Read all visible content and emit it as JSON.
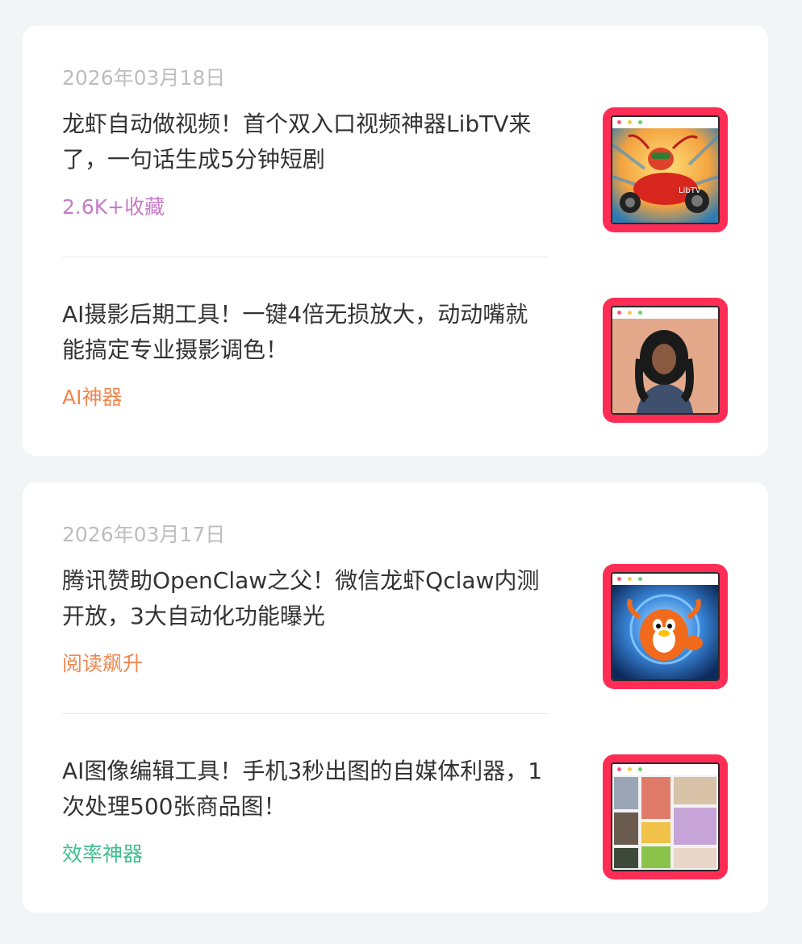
{
  "groups": [
    {
      "date": "2026年03月18日",
      "articles": [
        {
          "title": "龙虾自动做视频！首个双入口视频神器LibTV来了，一句话生成5分钟短剧",
          "tag": "2.6K+收藏",
          "tag_color": "#c57cc8",
          "thumbnail_label": "LibTV"
        },
        {
          "title": "AI摄影后期工具！一键4倍无损放大，动动嘴就能搞定专业摄影调色！",
          "tag": "AI神器",
          "tag_color": "#f0874e"
        }
      ]
    },
    {
      "date": "2026年03月17日",
      "articles": [
        {
          "title": "腾讯赞助OpenClaw之父！微信龙虾Qclaw内测开放，3大自动化功能曝光",
          "tag": "阅读飙升",
          "tag_color": "#f0874e"
        },
        {
          "title": "AI图像编辑工具！手机3秒出图的自媒体利器，1次处理500张商品图！",
          "tag": "效率神器",
          "tag_color": "#3fbf8e"
        }
      ]
    }
  ],
  "colors": {
    "background": "#f3f4f6",
    "card": "#ffffff",
    "thumbnail_frame": "#ff2d55",
    "date_text": "#bdbdbd",
    "title_text": "#333333"
  }
}
